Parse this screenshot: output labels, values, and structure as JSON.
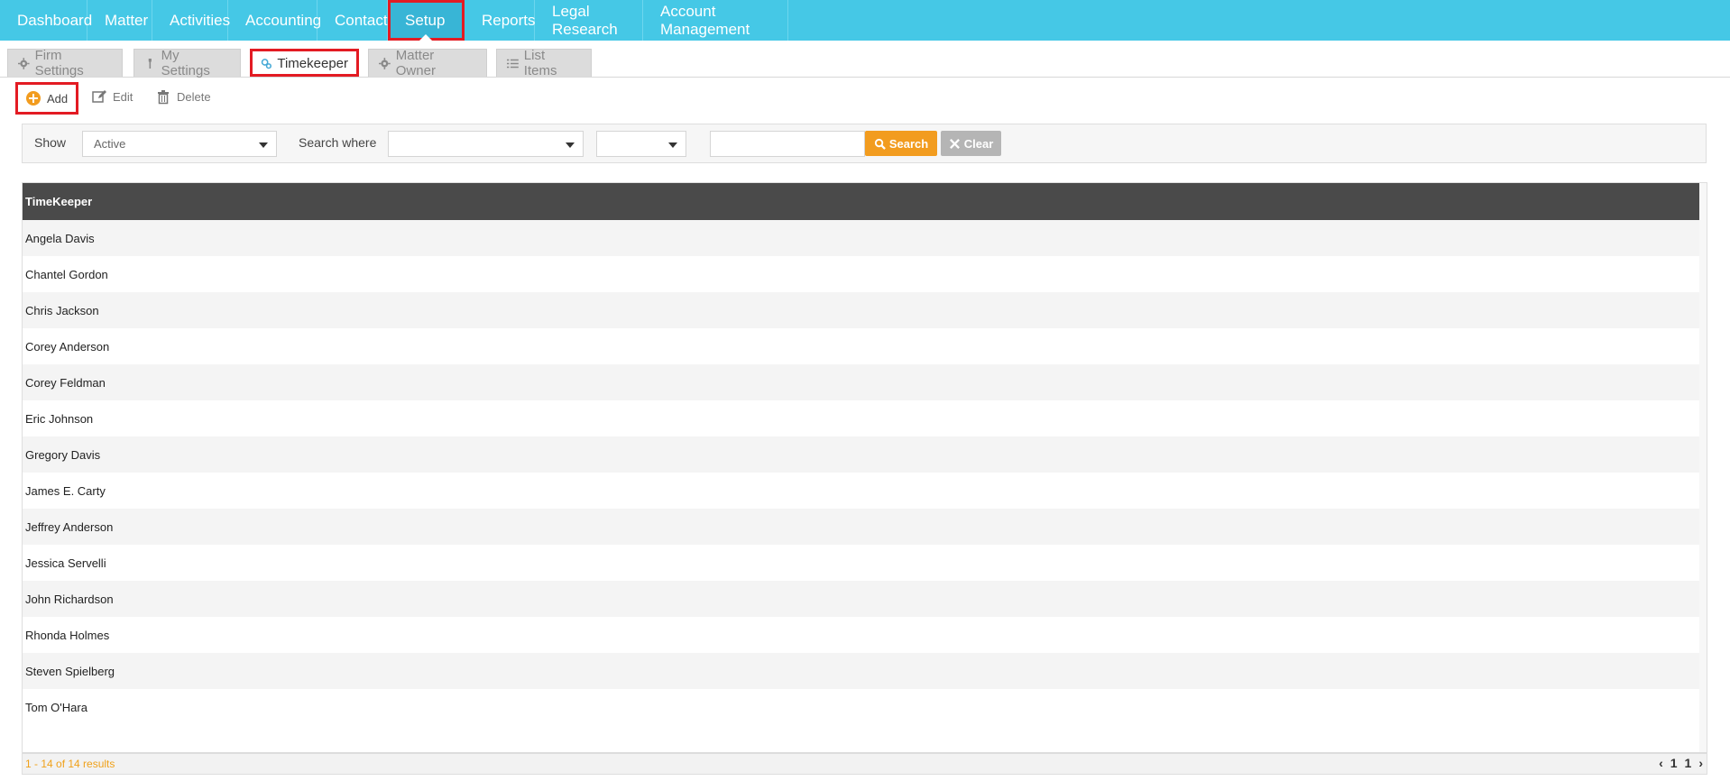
{
  "nav": {
    "items": [
      {
        "label": "Dashboard"
      },
      {
        "label": "Matter"
      },
      {
        "label": "Activities"
      },
      {
        "label": "Accounting"
      },
      {
        "label": "Contact"
      },
      {
        "label": "Setup"
      },
      {
        "label": "Reports"
      },
      {
        "label": "Legal Research"
      },
      {
        "label": "Account Management"
      }
    ],
    "active": "Setup"
  },
  "subtabs": [
    {
      "label": "Firm Settings",
      "icon": "gear-icon"
    },
    {
      "label": "My Settings",
      "icon": "wrench-icon"
    },
    {
      "label": "Timekeeper",
      "icon": "gears-icon"
    },
    {
      "label": "Matter Owner",
      "icon": "gear-icon"
    },
    {
      "label": "List Items",
      "icon": "list-icon"
    }
  ],
  "toolbar": {
    "add_label": "Add",
    "edit_label": "Edit",
    "delete_label": "Delete"
  },
  "filter": {
    "show_label": "Show",
    "show_value": "Active",
    "search_where_label": "Search where",
    "field_value": "",
    "operator_value": "",
    "search_text": "",
    "search_button": "Search",
    "clear_button": "Clear"
  },
  "grid": {
    "header": "TimeKeeper",
    "rows": [
      "Angela Davis",
      "Chantel Gordon",
      "Chris Jackson",
      "Corey Anderson",
      "Corey Feldman",
      "Eric Johnson",
      "Gregory Davis",
      "James E. Carty",
      "Jeffrey Anderson",
      "Jessica Servelli",
      "John Richardson",
      "Rhonda Holmes",
      "Steven Spielberg",
      "Tom O'Hara"
    ],
    "results_text": "1 - 14 of 14 results",
    "pager": {
      "prev": "‹",
      "page": "1",
      "pages": "1",
      "next": "›"
    }
  },
  "colors": {
    "nav_bg": "#45c8e6",
    "highlight": "#e31b23",
    "search_button": "#f29c1f",
    "clear_button": "#b5b5b5",
    "grid_header": "#4a4a4a",
    "add_icon": "#f29c1f"
  }
}
